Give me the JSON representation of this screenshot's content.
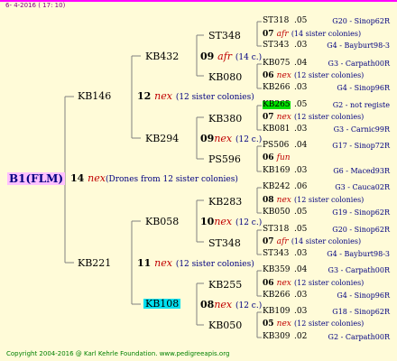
{
  "date": "6- 4-2016 ( 17: 10)",
  "root": {
    "name": "B1(FLM)",
    "num": "14",
    "code": "nex",
    "desc": "(Drones from 12 sister colonies)"
  },
  "gen2": [
    {
      "name": "KB146",
      "num": "12",
      "code": "nex",
      "desc": "(12 sister colonies)"
    },
    {
      "name": "KB221",
      "num": "11",
      "code": "nex",
      "desc": "(12 sister colonies)"
    }
  ],
  "gen3": [
    {
      "name": "KB432",
      "num": "09",
      "code": "afr",
      "desc": "(14 c.)"
    },
    {
      "name": "KB294",
      "num": "09",
      "code": "nex",
      "desc": "(12 c.)"
    },
    {
      "name": "KB058",
      "num": "10",
      "code": "nex",
      "desc": "(12 c.)"
    },
    {
      "name": "KB108",
      "num": "08",
      "code": "nex",
      "desc": "(12 c.)"
    }
  ],
  "gen4": [
    {
      "name": "ST348",
      "num": "07",
      "code": "afr",
      "desc": "(14 sister colonies)"
    },
    {
      "name": "KB080",
      "num": "06",
      "code": "nex",
      "desc": "(12 sister colonies)"
    },
    {
      "name": "KB380",
      "num": "07",
      "code": "nex",
      "desc": "(12 sister colonies)"
    },
    {
      "name": "PS596",
      "num": "06",
      "code": "fun",
      "desc": ""
    },
    {
      "name": "KB283",
      "num": "08",
      "code": "nex",
      "desc": "(12 sister colonies)"
    },
    {
      "name": "ST348",
      "num": "07",
      "code": "afr",
      "desc": "(14 sister colonies)"
    },
    {
      "name": "KB255",
      "num": "06",
      "code": "nex",
      "desc": "(12 sister colonies)"
    },
    {
      "name": "KB050",
      "num": "05",
      "code": "nex",
      "desc": "(12 sister colonies)"
    }
  ],
  "gen5": [
    {
      "name": "ST318",
      "num": ".05",
      "right": "G20 - Sinop62R"
    },
    {
      "name": "ST343",
      "num": ".03",
      "right": "G4 - Bayburt98-3"
    },
    {
      "name": "KB075",
      "num": ".04",
      "right": "G3 - Carpath00R"
    },
    {
      "name": "KB266",
      "num": ".03",
      "right": "G4 - Sinop96R"
    },
    {
      "name": "KB265",
      "num": ".05",
      "right": "G2 - not registe"
    },
    {
      "name": "KB081",
      "num": ".03",
      "right": "G3 - Carnic99R"
    },
    {
      "name": "PS506",
      "num": ".04",
      "right": "G17 - Sinop72R"
    },
    {
      "name": "KB169",
      "num": ".03",
      "right": "G6 - Maced93R"
    },
    {
      "name": "KB242",
      "num": ".06",
      "right": "G3 - Cauca02R"
    },
    {
      "name": "KB050",
      "num": ".05",
      "right": "G19 - Sinop62R"
    },
    {
      "name": "ST318",
      "num": ".05",
      "right": "G20 - Sinop62R"
    },
    {
      "name": "ST343",
      "num": ".03",
      "right": "G4 - Bayburt98-3"
    },
    {
      "name": "KB359",
      "num": ".04",
      "right": "G3 - Carpath00R"
    },
    {
      "name": "KB266",
      "num": ".03",
      "right": "G4 - Sinop96R"
    },
    {
      "name": "KB109",
      "num": ".03",
      "right": "G18 - Sinop62R"
    },
    {
      "name": "KB309",
      "num": ".02",
      "right": "G2 - Carpath00R"
    }
  ],
  "footer": "Copyright 2004-2016 @ Karl Kehrle Foundation.   www.pedigreeapis.org",
  "colors": {
    "background": "#fffbd8",
    "root_highlight": "#ffc0ff",
    "green_highlight": "#00e000",
    "cyan_highlight": "#00e0f0",
    "code_red": "#c00000",
    "navy": "#000080"
  }
}
